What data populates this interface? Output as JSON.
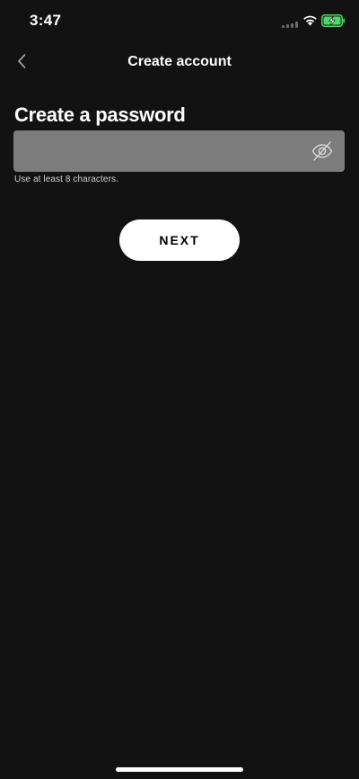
{
  "status_bar": {
    "time": "3:47",
    "colors": {
      "battery_charging": "#4cd964"
    }
  },
  "nav": {
    "back_icon": "chevron-left-icon",
    "title": "Create account"
  },
  "form": {
    "heading": "Create a password",
    "password": {
      "value": "",
      "placeholder": "",
      "toggle_icon": "eye-slash-icon"
    },
    "helper_text": "Use at least 8 characters.",
    "next_label": "NEXT"
  },
  "colors": {
    "background": "#121212",
    "input_background": "#7c7c7c",
    "button_background": "#ffffff",
    "button_text": "#000000"
  }
}
